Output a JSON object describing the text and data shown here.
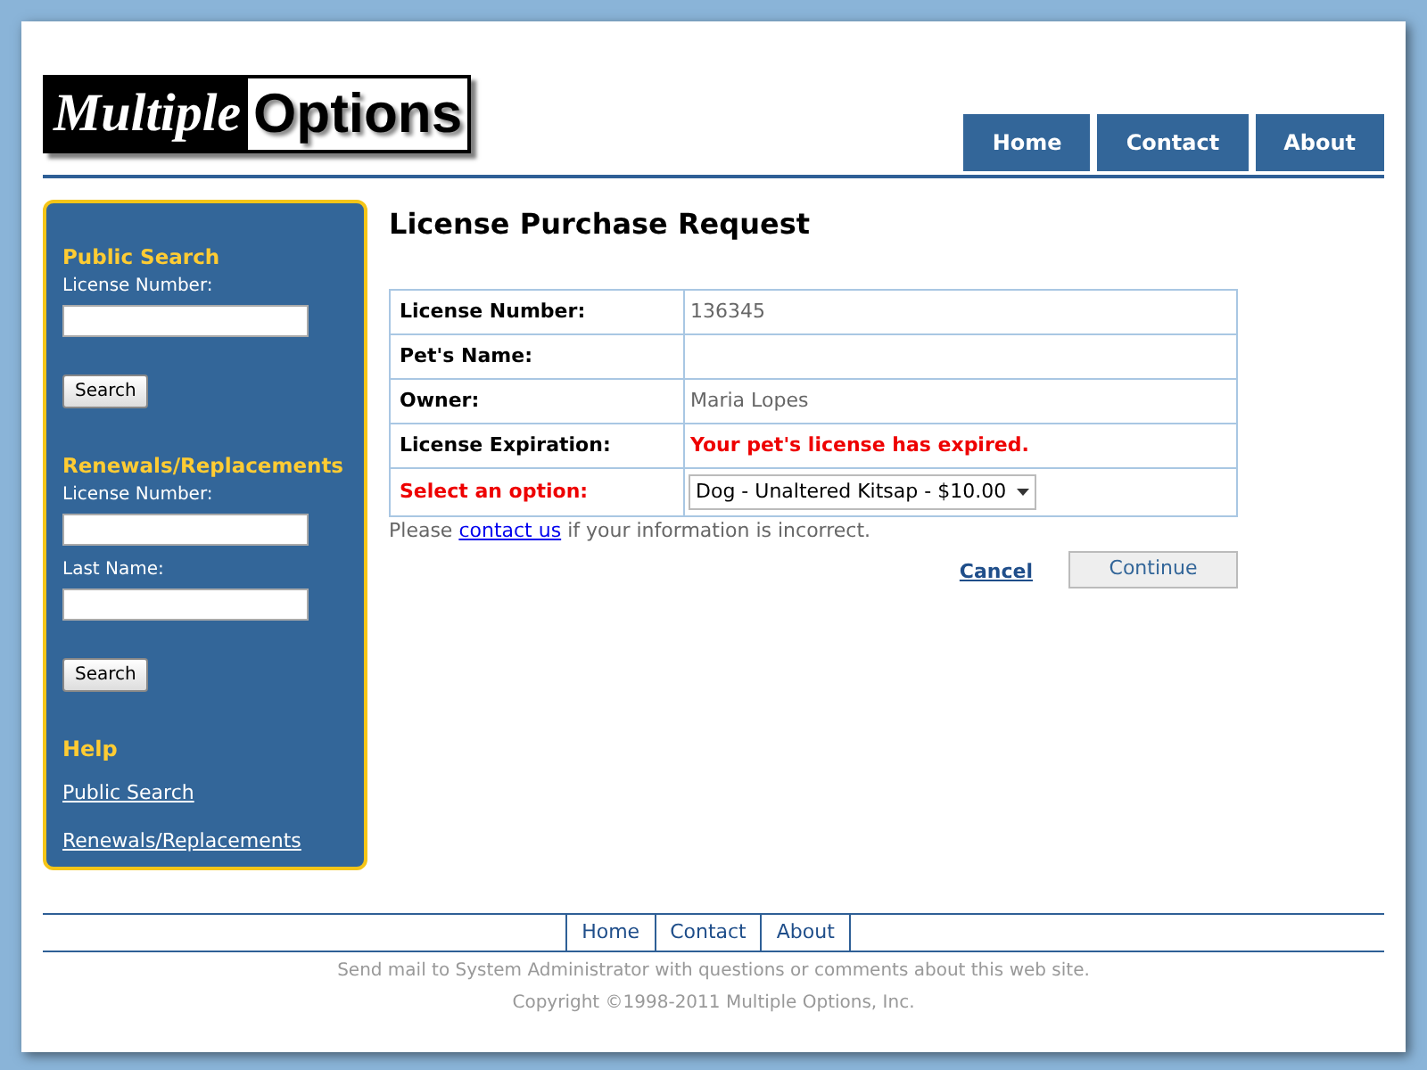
{
  "logo": {
    "part_1": "Multiple",
    "part_2": "Options"
  },
  "nav": [
    "Home",
    "Contact",
    "About"
  ],
  "sidebar": {
    "sections": [
      {
        "title": "Public Search",
        "fields": [
          {
            "label": "License Number:"
          }
        ],
        "button": "Search"
      },
      {
        "title": "Renewals/Replacements",
        "fields": [
          {
            "label": "License Number:"
          },
          {
            "label": "Last Name:"
          }
        ],
        "button": "Search"
      }
    ],
    "help": {
      "title": "Help",
      "links": [
        "Public Search",
        "Renewals/Replacements"
      ]
    }
  },
  "main": {
    "title": "License Purchase Request",
    "rows": [
      {
        "label": "License Number:",
        "kind": "text",
        "value": "136345"
      },
      {
        "label": "Pet's Name:",
        "kind": "text",
        "value": ""
      },
      {
        "label": "Owner:",
        "kind": "text",
        "value": "Maria Lopes"
      },
      {
        "label": "License Expiration:",
        "kind": "error",
        "value": "Your pet's license has expired."
      },
      {
        "label": "Select an option:",
        "kind": "select",
        "value": "Dog - Unaltered Kitsap - $10.00"
      }
    ],
    "note": {
      "before": "Please",
      "link": "contact us",
      "after": "if your information is incorrect."
    },
    "cancel": "Cancel",
    "continue": "Continue"
  },
  "footer": {
    "nav": [
      "Home",
      "Contact",
      "About"
    ],
    "lines": [
      "Send mail to System Administrator with questions or comments about this web site.",
      "Copyright ©1998-2011 Multiple Options, Inc."
    ]
  }
}
